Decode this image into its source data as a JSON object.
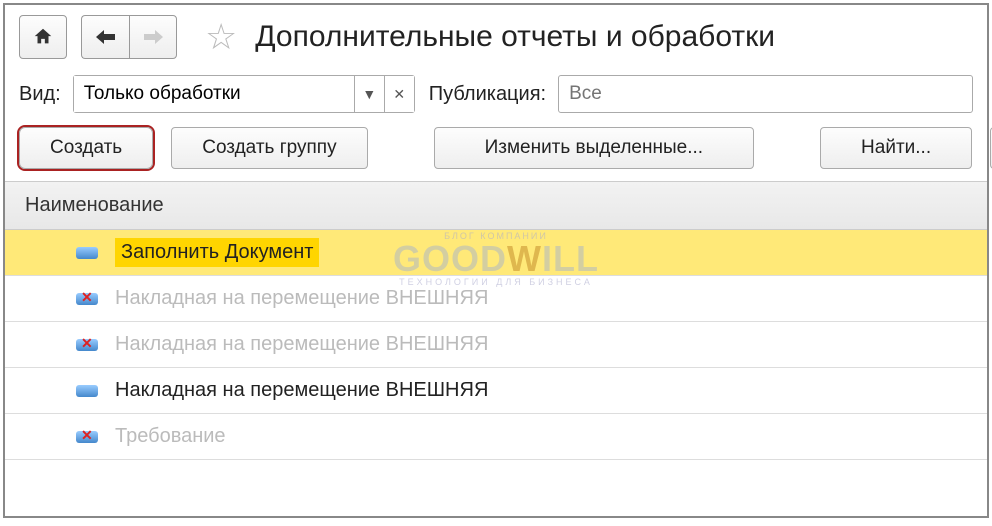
{
  "title": "Дополнительные отчеты и обработки",
  "filters": {
    "kind_label": "Вид:",
    "kind_value": "Только обработки",
    "pub_label": "Публикация:",
    "pub_placeholder": "Все"
  },
  "toolbar": {
    "create": "Создать",
    "create_group": "Создать группу",
    "change_selected": "Изменить выделенные...",
    "find": "Найти..."
  },
  "list": {
    "header": "Наименование",
    "rows": [
      {
        "text": "Заполнить Документ",
        "selected": true,
        "deleted": false,
        "disabled": false
      },
      {
        "text": "Накладная на перемещение ВНЕШНЯЯ",
        "selected": false,
        "deleted": true,
        "disabled": true
      },
      {
        "text": "Накладная на перемещение ВНЕШНЯЯ",
        "selected": false,
        "deleted": true,
        "disabled": true
      },
      {
        "text": "Накладная на перемещение ВНЕШНЯЯ",
        "selected": false,
        "deleted": false,
        "disabled": false
      },
      {
        "text": "Требование",
        "selected": false,
        "deleted": true,
        "disabled": true
      }
    ]
  },
  "watermark": {
    "top": "БЛОГ КОМПАНИИ",
    "main1": "GOOD",
    "main2": "W",
    "main3": "ILL",
    "sub": "ТЕХНОЛОГИИ ДЛЯ БИЗНЕСА"
  }
}
